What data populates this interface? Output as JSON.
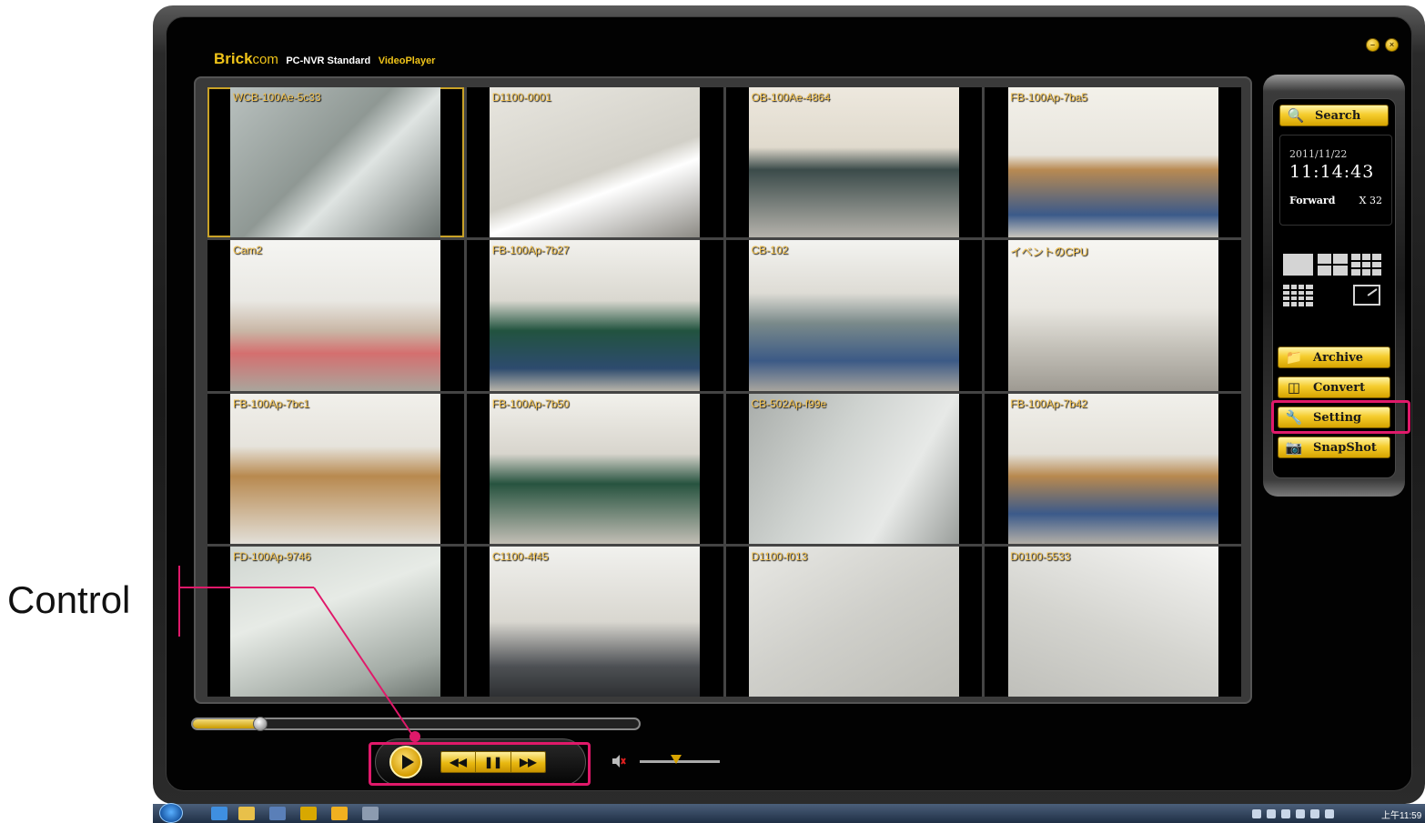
{
  "annotation": {
    "label": "Control",
    "color": "#e0196a"
  },
  "app": {
    "brand_bold": "Brick",
    "brand_rest": "com",
    "product": "PC-NVR Standard",
    "player": "VideoPlayer",
    "window_buttons": [
      "minimize",
      "close"
    ]
  },
  "cameras": [
    {
      "label": "WCB-100Ae-5c33",
      "selected": true
    },
    {
      "label": "D1100-0001",
      "selected": false
    },
    {
      "label": "OB-100Ae-4864",
      "selected": false
    },
    {
      "label": "FB-100Ap-7ba5",
      "selected": false
    },
    {
      "label": "Cam2",
      "selected": false
    },
    {
      "label": "FB-100Ap-7b27",
      "selected": false
    },
    {
      "label": "CB-102",
      "selected": false
    },
    {
      "label": "イベントのCPU",
      "selected": false
    },
    {
      "label": "FB-100Ap-7bc1",
      "selected": false
    },
    {
      "label": "FB-100Ap-7b50",
      "selected": false
    },
    {
      "label": "CB-502Ap-f99e",
      "selected": false
    },
    {
      "label": "FB-100Ap-7b42",
      "selected": false
    },
    {
      "label": "FD-100Ap-9746",
      "selected": false
    },
    {
      "label": "C1100-4f45",
      "selected": false
    },
    {
      "label": "D1100-f013",
      "selected": false
    },
    {
      "label": "D0100-5533",
      "selected": false
    }
  ],
  "sidebar": {
    "search_label": "Search",
    "date": "2011/11/22",
    "time": "11:14:43",
    "direction": "Forward",
    "speed": "X 32",
    "archive_label": "Archive",
    "convert_label": "Convert",
    "setting_label": "Setting",
    "snapshot_label": "SnapShot"
  },
  "playback": {
    "progress": 0.15,
    "volume": 0.45,
    "controls": [
      "rewind",
      "pause",
      "fast-forward"
    ]
  },
  "taskbar": {
    "clock": "上午11:59"
  },
  "colors": {
    "accent": "#f0c419",
    "highlight": "#e0196a",
    "label": "#f2c14e"
  }
}
